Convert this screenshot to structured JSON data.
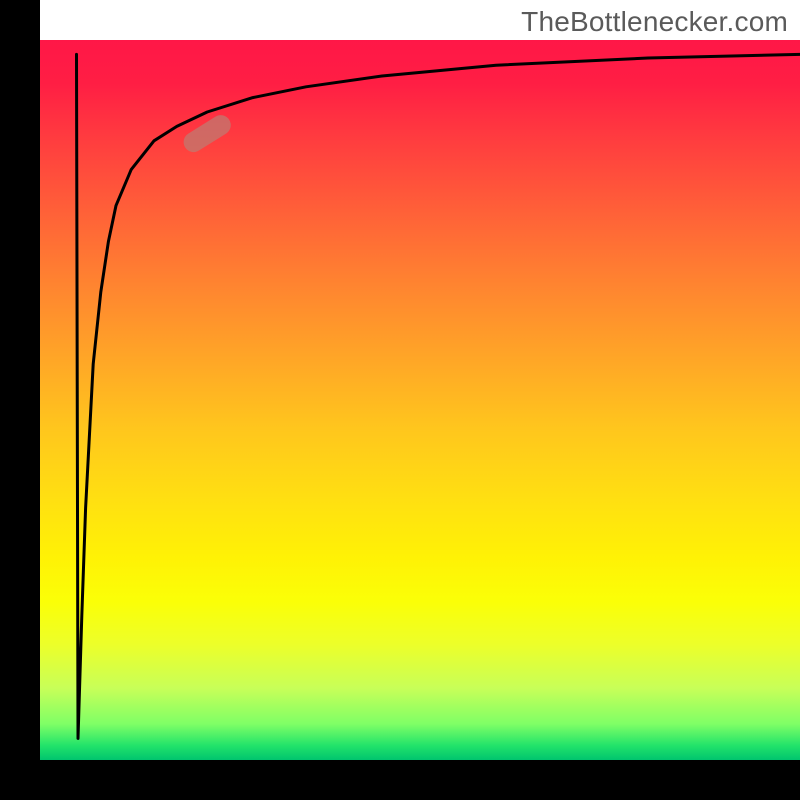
{
  "watermark": "TheBottlenecker.com",
  "marker": {
    "color": "#c07a70",
    "x_pct": 22,
    "y_pct": 87
  },
  "chart_data": {
    "type": "line",
    "title": "",
    "xlabel": "",
    "ylabel": "",
    "xlim": [
      0,
      100
    ],
    "ylim": [
      0,
      100
    ],
    "grid": false,
    "background_gradient": "red-yellow-green vertical gradient (bottleneck severity heatmap)",
    "axes": {
      "left": "black solid",
      "bottom": "black solid"
    },
    "series": [
      {
        "name": "bottleneck-curve",
        "color": "#000000",
        "x": [
          5,
          5.5,
          6,
          7,
          8,
          9,
          10,
          12,
          15,
          18,
          22,
          28,
          35,
          45,
          60,
          80,
          100
        ],
        "y": [
          3,
          20,
          35,
          55,
          65,
          72,
          77,
          82,
          86,
          88,
          90,
          92,
          93.5,
          95,
          96.5,
          97.5,
          98
        ]
      }
    ],
    "annotations": [
      {
        "type": "marker-pill",
        "x": 22,
        "y": 87,
        "color": "#c07a70",
        "note": "highlighted point on curve (semi-transparent rounded marker)"
      }
    ]
  }
}
